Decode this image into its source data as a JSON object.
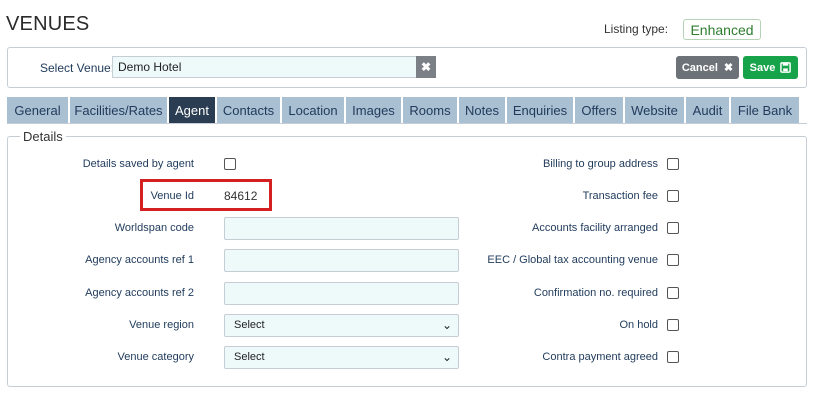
{
  "header": {
    "title": "VENUES",
    "listing_type_label": "Listing type:",
    "listing_type_value": "Enhanced"
  },
  "venue_select": {
    "label": "Select Venue:",
    "value": "Demo Hotel",
    "clear_icon": "close-icon",
    "cancel_label": "Cancel",
    "save_label": "Save"
  },
  "tabs": [
    {
      "label": "General"
    },
    {
      "label": "Facilities/Rates"
    },
    {
      "label": "Agent",
      "active": true
    },
    {
      "label": "Contacts"
    },
    {
      "label": "Location"
    },
    {
      "label": "Images"
    },
    {
      "label": "Rooms"
    },
    {
      "label": "Notes"
    },
    {
      "label": "Enquiries"
    },
    {
      "label": "Offers"
    },
    {
      "label": "Website"
    },
    {
      "label": "Audit"
    },
    {
      "label": "File Bank"
    }
  ],
  "details": {
    "legend": "Details",
    "left": {
      "saved_by_agent": {
        "label": "Details saved by agent",
        "checked": false
      },
      "venue_id": {
        "label": "Venue Id",
        "value": "84612"
      },
      "worldspan_code": {
        "label": "Worldspan code",
        "value": ""
      },
      "agency_ref_1": {
        "label": "Agency accounts ref 1",
        "value": ""
      },
      "agency_ref_2": {
        "label": "Agency accounts ref 2",
        "value": ""
      },
      "venue_region": {
        "label": "Venue region",
        "value": "Select"
      },
      "venue_category": {
        "label": "Venue category",
        "value": "Select"
      }
    },
    "right": [
      {
        "label": "Billing to group address",
        "checked": false
      },
      {
        "label": "Transaction fee",
        "checked": false
      },
      {
        "label": "Accounts facility arranged",
        "checked": false
      },
      {
        "label": "EEC / Global tax accounting venue",
        "checked": false
      },
      {
        "label": "Confirmation no. required",
        "checked": false
      },
      {
        "label": "On hold",
        "checked": false
      },
      {
        "label": "Contra payment agreed",
        "checked": false
      }
    ]
  },
  "colors": {
    "active_tab": "#2b3d52",
    "tab": "#a9bfd2",
    "save": "#16a34a",
    "cancel": "#6d7279",
    "highlight": "#d32020"
  }
}
